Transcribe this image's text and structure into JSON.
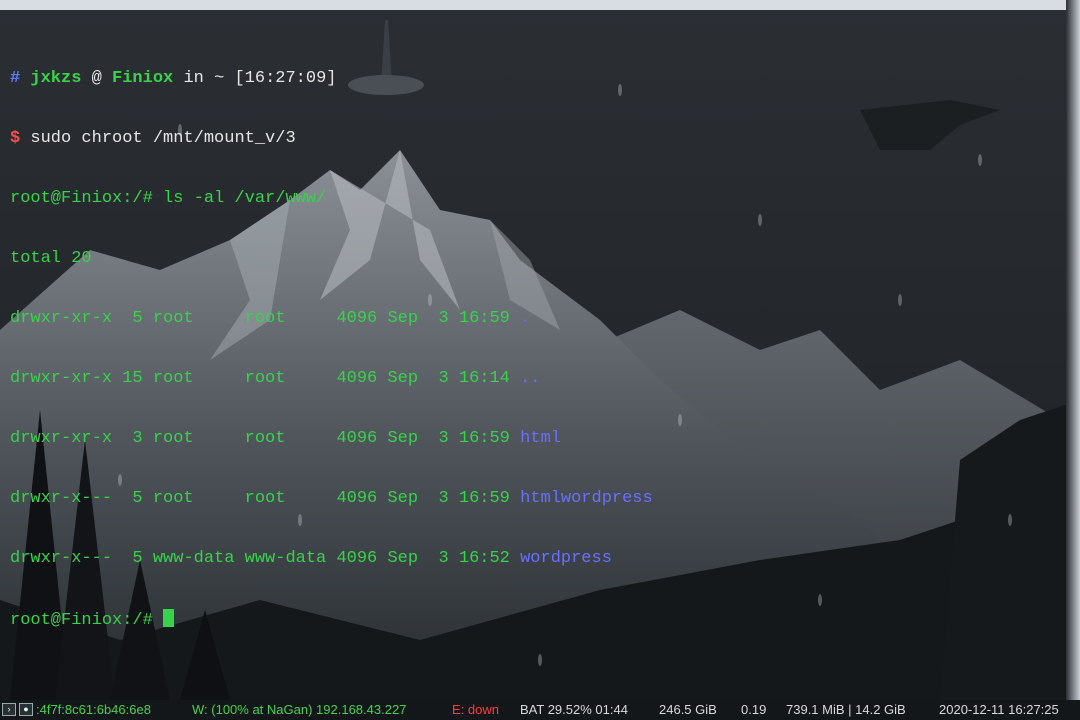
{
  "terminal": {
    "prompt_line": {
      "hash": "#",
      "user": "jxkzs",
      "at": "@",
      "host": "Finiox",
      "in": "in",
      "dir": "~",
      "time": "[16:27:09]"
    },
    "command_line": {
      "dollar": "$",
      "command": "sudo chroot /mnt/mount_v/3"
    },
    "root_prompt_1": "root@Finiox:/# ls -al /var/www/",
    "total": "total 20",
    "listing": [
      {
        "meta": "drwxr-xr-x  5 root     root     4096 Sep  3 16:59 ",
        "name": "."
      },
      {
        "meta": "drwxr-xr-x 15 root     root     4096 Sep  3 16:14 ",
        "name": ".."
      },
      {
        "meta": "drwxr-xr-x  3 root     root     4096 Sep  3 16:59 ",
        "name": "html"
      },
      {
        "meta": "drwxr-x---  5 root     root     4096 Sep  3 16:59 ",
        "name": "htmlwordpress"
      },
      {
        "meta": "drwxr-x---  5 www-data www-data 4096 Sep  3 16:52 ",
        "name": "wordpress"
      }
    ],
    "root_prompt_2": "root@Finiox:/# "
  },
  "statusbar": {
    "ipv6": ":4f7f:8c61:6b46:6e8",
    "wifi": "W: (100% at NaGan) 192.168.43.227",
    "ethernet": "E: down",
    "battery": "BAT 29.52% 01:44",
    "disk": "246.5 GiB",
    "load": "0.19",
    "memory": "739.1 MiB | 14.2 GiB",
    "datetime": "2020-12-11 16:27:25"
  },
  "colors": {
    "terminal_green": "#37d34a",
    "directory_blue": "#6870ff",
    "prompt_red": "#ff4d4d",
    "prompt_hash_blue": "#5b7cff"
  }
}
